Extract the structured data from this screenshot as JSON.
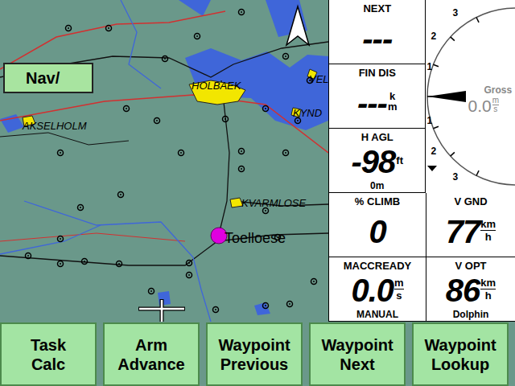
{
  "map": {
    "mode_label": "Nav/",
    "places": [
      {
        "name": "HOLBAEK",
        "kind": "town"
      },
      {
        "name": "VEL",
        "kind": "town"
      },
      {
        "name": "KYND",
        "kind": "town"
      },
      {
        "name": "AKSELHOLM",
        "kind": "town"
      },
      {
        "name": "KVARMLOSE",
        "kind": "town"
      },
      {
        "name": "Toelloese",
        "kind": "home"
      }
    ]
  },
  "left_column": [
    {
      "title": "NEXT",
      "value": "---",
      "unit_top": "",
      "unit_bottom": "",
      "unit_line": false,
      "comment": ""
    },
    {
      "title": "FIN DIS",
      "value": "---",
      "unit_top": "k",
      "unit_bottom": "m",
      "unit_line": false,
      "comment": ""
    },
    {
      "title": "H AGL",
      "value": "-98",
      "unit_top": "ft",
      "unit_bottom": "",
      "unit_line": false,
      "comment": "0m"
    }
  ],
  "vario": {
    "label": "Gross",
    "value": "0.0",
    "unit_top": "m",
    "unit_bottom": "s",
    "scale": [
      "3",
      "2",
      "1",
      "1",
      "2",
      "3"
    ]
  },
  "bottom_boxes": [
    {
      "title": "% CLIMB",
      "value": "0",
      "unit_top": "",
      "unit_bottom": "",
      "unit_line": false,
      "comment": ""
    },
    {
      "title": "V GND",
      "value": "77",
      "unit_top": "km",
      "unit_bottom": "h",
      "unit_line": true,
      "comment": ""
    },
    {
      "title": "MACCREADY",
      "value": "0.0",
      "unit_top": "m",
      "unit_bottom": "s",
      "unit_line": true,
      "comment": "MANUAL"
    },
    {
      "title": "V OPT",
      "value": "86",
      "unit_top": "km",
      "unit_bottom": "h",
      "unit_line": true,
      "comment": "Dolphin"
    }
  ],
  "buttons": [
    {
      "lines": [
        "Task",
        "Calc"
      ]
    },
    {
      "lines": [
        "Arm",
        "Advance"
      ]
    },
    {
      "lines": [
        "Waypoint",
        "Previous"
      ]
    },
    {
      "lines": [
        "Waypoint",
        "Next"
      ]
    },
    {
      "lines": [
        "Waypoint",
        "Lookup"
      ]
    }
  ]
}
